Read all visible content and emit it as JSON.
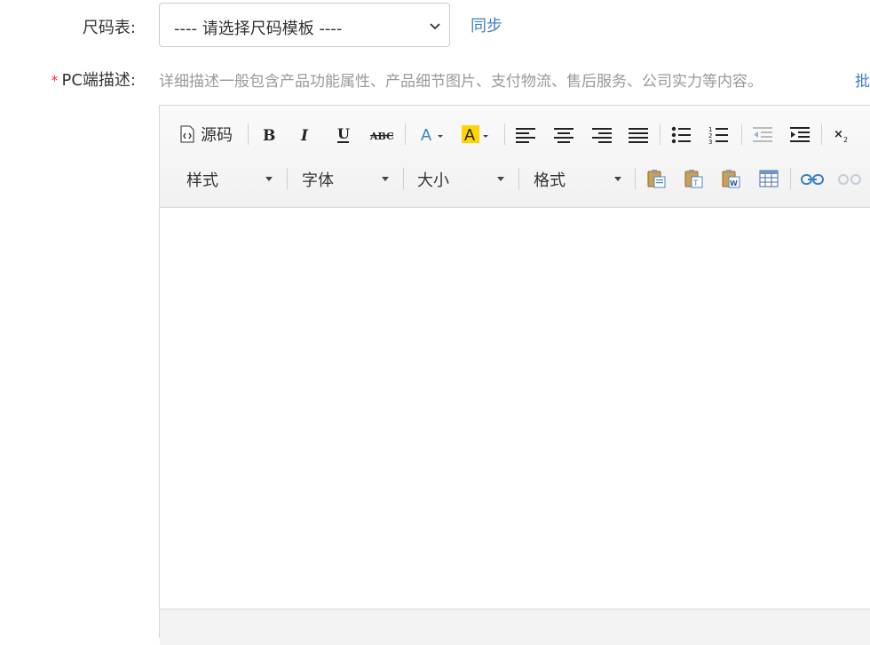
{
  "size_chart": {
    "label": "尺码表:",
    "select_value": "---- 请选择尺码模板 ----",
    "sync_link": "同步"
  },
  "pc_description": {
    "required_mark": "*",
    "label": "PC端描述:",
    "hint": "详细描述一般包含产品功能属性、产品细节图片、支付物流、售后服务、公司实力等内容。",
    "hint_link": "批"
  },
  "editor": {
    "toolbar": {
      "source_label": "源码",
      "combos": [
        "样式",
        "字体",
        "大小",
        "格式"
      ],
      "icons": [
        "source-icon",
        "bold-icon",
        "italic-icon",
        "underline-icon",
        "strikethrough-icon",
        "text-color-icon",
        "bg-color-icon",
        "align-left-icon",
        "align-center-icon",
        "align-right-icon",
        "justify-icon",
        "bulleted-list-icon",
        "numbered-list-icon",
        "outdent-icon",
        "indent-icon",
        "subscript-icon",
        "paste-icon",
        "paste-text-icon",
        "paste-word-icon",
        "table-icon",
        "link-icon",
        "unlink-icon"
      ]
    },
    "content": ""
  },
  "colors": {
    "link": "#3d7fc1",
    "required": "#e4393c",
    "hint": "#999999",
    "highlight": "#ffd400"
  }
}
